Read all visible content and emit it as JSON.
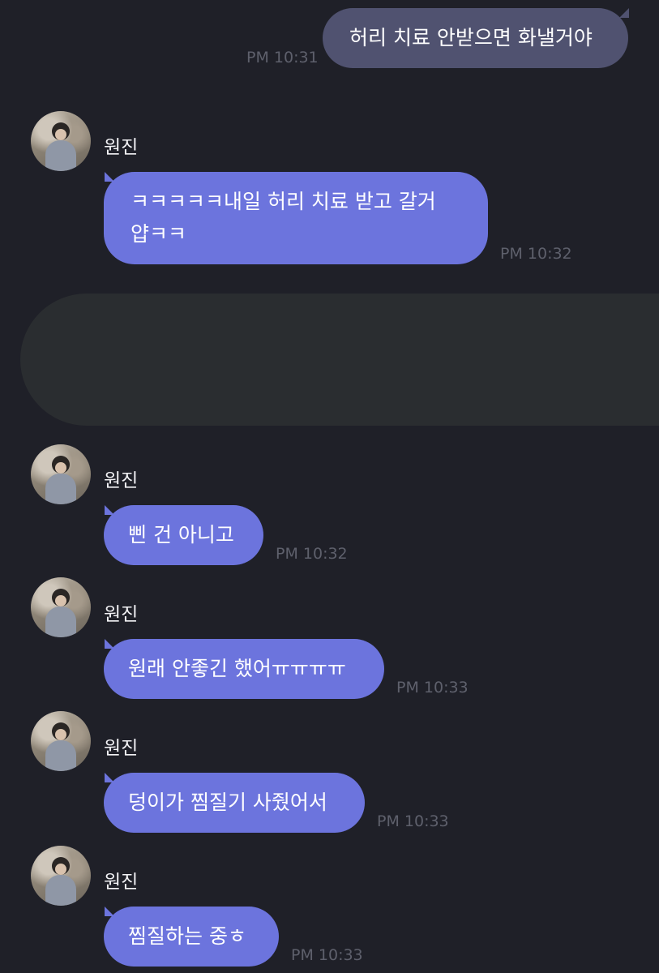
{
  "messages": [
    {
      "id": "m1",
      "direction": "sent",
      "text": "허리 치료 안받으면 화낼거야",
      "time": "PM 10:31"
    },
    {
      "id": "m2",
      "direction": "received",
      "sender": "원진",
      "lines": [
        "ㅋㅋㅋㅋㅋ내일 허리 치료 받고 갈거",
        "얍ㅋㅋ"
      ],
      "time": "PM 10:32"
    },
    {
      "id": "m3",
      "direction": "received",
      "sender": "원진",
      "text": "삔 건 아니고",
      "time": "PM 10:32"
    },
    {
      "id": "m4",
      "direction": "received",
      "sender": "원진",
      "text": "원래 안좋긴 했어ㅠㅠㅠㅠ",
      "time": "PM 10:33"
    },
    {
      "id": "m5",
      "direction": "received",
      "sender": "원진",
      "text": "덩이가 찜질기 사줬어서",
      "time": "PM 10:33"
    },
    {
      "id": "m6",
      "direction": "received",
      "sender": "원진",
      "text": "찜질하는 중ㅎ",
      "time": "PM 10:33"
    }
  ],
  "colors": {
    "background": "#1f2028",
    "sent_bubble": "#505270",
    "received_bubble": "#6c74dd",
    "timestamp": "#5e606c",
    "redacted_block": "#2a2d30"
  },
  "icons": {
    "avatar": "profile-photo-avatar"
  }
}
